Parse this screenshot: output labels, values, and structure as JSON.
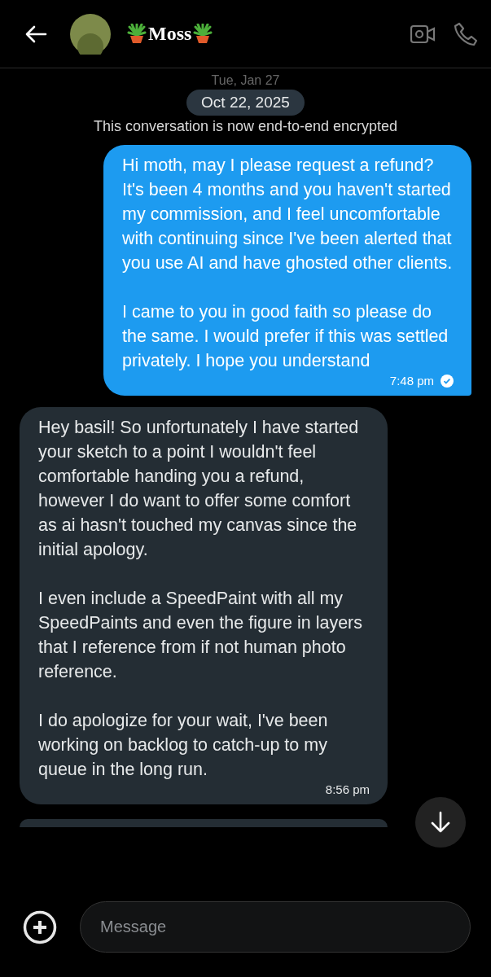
{
  "header": {
    "title": "Moss"
  },
  "date_separator": "Tue, Jan 27",
  "date_chip": "Oct 22, 2025",
  "notice": "This conversation is now end-to-end encrypted",
  "messages": [
    {
      "kind": "sent",
      "text": "Hi moth, may I please request a refund? It's been 4 months and you haven't started my commission, and I feel uncomfortable with continuing since I've been alerted that you use AI and have ghosted other clients.\n\nI came to you in good faith so please do the same. I would prefer if this was settled privately. I hope you understand",
      "time": "7:48 pm",
      "read": true
    },
    {
      "kind": "received",
      "text": "Hey basil! So unfortunately I have started your sketch to a point I wouldn't feel comfortable handing you a refund, however I do want to offer some comfort as ai hasn't touched my canvas since the initial apology.\n\nI even include a SpeedPaint with all my SpeedPaints and even the figure in layers that I reference from if not human photo reference.\n\nI do apologize for your wait, I've been working on backlog to catch-up to my queue in the long run.",
      "time": "8:56 pm"
    }
  ],
  "composer": {
    "placeholder": "Message"
  }
}
